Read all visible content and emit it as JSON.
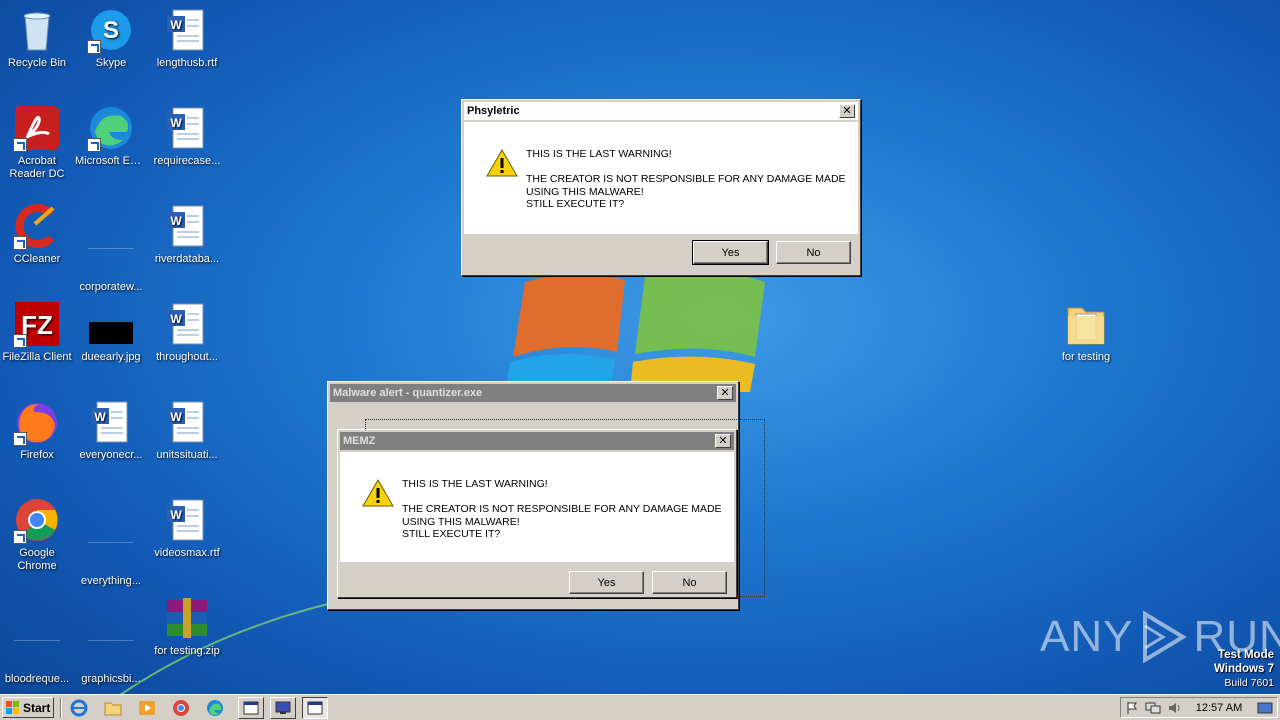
{
  "desktop": {
    "icons": [
      {
        "label": "Recycle Bin"
      },
      {
        "label": "Skype"
      },
      {
        "label": "lengthusb.rtf"
      },
      {
        "label": "Acrobat Reader DC"
      },
      {
        "label": "Microsoft Edge"
      },
      {
        "label": "requirecase..."
      },
      {
        "label": "CCleaner"
      },
      {
        "label": "corporatew..."
      },
      {
        "label": "riverdataba..."
      },
      {
        "label": "FileZilla Client"
      },
      {
        "label": "dueearly.jpg"
      },
      {
        "label": "throughout..."
      },
      {
        "label": "Firefox"
      },
      {
        "label": "everyonecr..."
      },
      {
        "label": "unitssituati..."
      },
      {
        "label": "Google Chrome"
      },
      {
        "label": "everything..."
      },
      {
        "label": "videosmax.rtf"
      },
      {
        "label": "bloodreque..."
      },
      {
        "label": "graphicsbi..."
      },
      {
        "label": "for testing.zip"
      },
      {
        "label": "for testing"
      }
    ]
  },
  "dialogs": {
    "phsyletric": {
      "title": "Phsyletric",
      "line1": "THIS IS THE LAST WARNING!",
      "line2": "THE CREATOR IS NOT RESPONSIBLE FOR ANY DAMAGE MADE",
      "line3": "USING THIS MALWARE!",
      "line4": "STILL EXECUTE IT?",
      "yes": "Yes",
      "no": "No"
    },
    "malware_alert": {
      "title": "Malware alert - quantizer.exe"
    },
    "memz": {
      "title": "MEMZ",
      "line1": "THIS IS THE LAST WARNING!",
      "line2": "THE CREATOR IS NOT RESPONSIBLE FOR ANY DAMAGE MADE",
      "line3": "USING THIS MALWARE!",
      "line4": "STILL EXECUTE IT?",
      "yes": "Yes",
      "no": "No"
    }
  },
  "watermark": {
    "brand_left": "ANY",
    "brand_right": "RUN",
    "test_mode": "Test Mode",
    "os": "Windows 7",
    "build": "Build 7601"
  },
  "taskbar": {
    "start_label": "Start",
    "clock": "12:57 AM"
  },
  "colors": {
    "desktop": "#1f79d1",
    "dialog_face": "#d4d0c8",
    "inactive_title": "#808080"
  }
}
